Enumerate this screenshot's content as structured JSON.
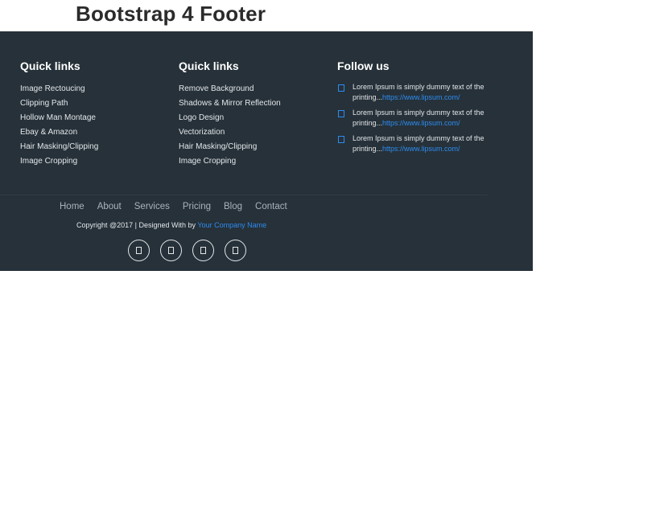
{
  "page": {
    "title": "Bootstrap 4 Footer"
  },
  "footer": {
    "columns": [
      {
        "heading": "Quick links",
        "items": [
          "Image Rectoucing",
          "Clipping Path",
          "Hollow Man Montage",
          "Ebay & Amazon",
          "Hair Masking/Clipping",
          "Image Cropping"
        ]
      },
      {
        "heading": "Quick links",
        "items": [
          "Remove Background",
          "Shadows & Mirror Reflection",
          "Logo Design",
          "Vectorization",
          "Hair Masking/Clipping",
          "Image Cropping"
        ]
      }
    ],
    "follow": {
      "heading": "Follow us",
      "items": [
        {
          "text": "Lorem Ipsum is simply dummy text of the printing...",
          "link": "https://www.lipsum.com/"
        },
        {
          "text": "Lorem Ipsum is simply dummy text of the printing...",
          "link": "https://www.lipsum.com/"
        },
        {
          "text": "Lorem Ipsum is simply dummy text of the printing...",
          "link": "https://www.lipsum.com/"
        }
      ]
    },
    "nav": [
      "Home",
      "About",
      "Services",
      "Pricing",
      "Blog",
      "Contact"
    ],
    "copyright": {
      "text": "Copyright @2017 | Designed With by ",
      "company": "Your Company Name"
    },
    "social_icons": [
      "social-icon-1",
      "social-icon-2",
      "social-icon-3",
      "social-icon-4"
    ]
  },
  "colors": {
    "footer_bg": "#263139",
    "accent": "#2d8cf0",
    "title": "#2b2b2b"
  }
}
